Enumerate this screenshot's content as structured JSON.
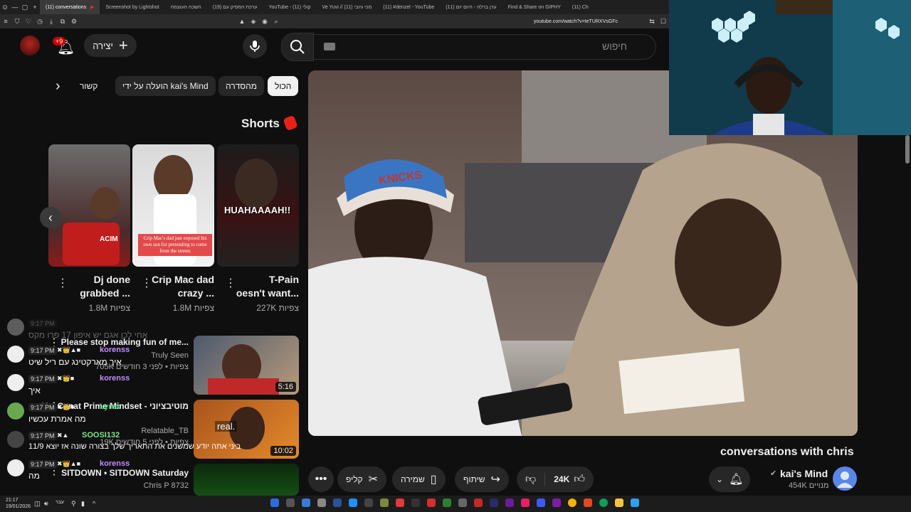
{
  "browser": {
    "tabs": [
      {
        "label": "(11) conversations",
        "active": true
      },
      {
        "label": "Screenshot by Lightshot"
      },
      {
        "label": "חשכה העוצמה"
      },
      {
        "label": "(19) ערכת המפיק עם"
      },
      {
        "label": "YouTube - (11) קולי"
      },
      {
        "label": "Ve Yuvi // (11) מכי גיובי"
      },
      {
        "label": "(11) #denzel - YouTube"
      },
      {
        "label": "(11) ערן ברלה - היום יום"
      },
      {
        "label": "Find & Share on GIPHY"
      },
      {
        "label": "(11) Ch"
      }
    ],
    "url": "youtube.com/watch?v=teTURXVsGFc"
  },
  "header": {
    "search_placeholder": "חיפוש",
    "create_label": "יצירה",
    "notif_count": "+9"
  },
  "chips": [
    "הכול",
    "מהסדרה",
    "הועלה על ידי kai's Mind",
    "קשור"
  ],
  "shorts": {
    "title": "Shorts",
    "items": [
      {
        "title_line1": "T-Pain",
        "title_line2": "oesn't want...",
        "views": "227K צפיות",
        "overlay": "HUAHAAAAH!!"
      },
      {
        "title_line1": "Crip Mac dad",
        "title_line2": "crazy ...",
        "views": "1.8M צפיות",
        "caption": "Crip Mac's dad just exposed his own son for pretending to come from the streets"
      },
      {
        "title_line1": "Dj done",
        "title_line2": "grabbed ...",
        "views": "1.8M צפיות",
        "overlay": "ACIM"
      }
    ]
  },
  "side_videos": [
    {
      "title": "Please stop making fun of me...",
      "channel": "Truly Seen",
      "meta": "705K צפיות • לפני 3 חודשים",
      "duration": "5:16"
    },
    {
      "title": "Kai Cenat Prime Mindset - מוטיבציוני",
      "channel": "Relatable_TB",
      "meta": "19K צפיות • לפני 5 חודשים",
      "duration": "10:02",
      "overlay": "real."
    },
    {
      "title": "SITDOWN • SITDOWN Saturday",
      "channel": "Chris P 8732",
      "meta": "",
      "duration": ""
    }
  ],
  "chat": [
    {
      "time": "9:17 PM",
      "name": "",
      "msg": "אחי לכן אגם יש איפון 17 פרו מקס"
    },
    {
      "time": "9:17 PM",
      "name": "korenss",
      "msg": "איך מארקטינג עם ריל שיט"
    },
    {
      "time": "9:17 PM",
      "name": "korenss",
      "msg": "איך"
    },
    {
      "time": "9:17 PM",
      "name": "Lyrex",
      "msg": "מה אמרת עכשיו"
    },
    {
      "time": "9:17 PM",
      "name": "SOOSI132",
      "msg": "11/9 ביני אתה יודע שמשנים את התאריך שלך בצורה שונה אז יוצא"
    },
    {
      "time": "9:17 PM",
      "name": "korenss",
      "msg": "מה"
    }
  ],
  "video": {
    "title": "conversations with chris",
    "channel": "kai's Mind",
    "subscribers": "454K מנויים",
    "likes": "24K",
    "share": "שיתוף",
    "save": "שמירה",
    "clip": "קליפ",
    "hat_text": "KNICKS"
  },
  "taskbar": {
    "time": "21:17",
    "date": "19/01/2026",
    "lang": "עבר"
  },
  "colors": {
    "bg": "#0f0f0f",
    "chip": "#272727",
    "accent": "#ff0033",
    "chat_name": "#c58bff"
  }
}
